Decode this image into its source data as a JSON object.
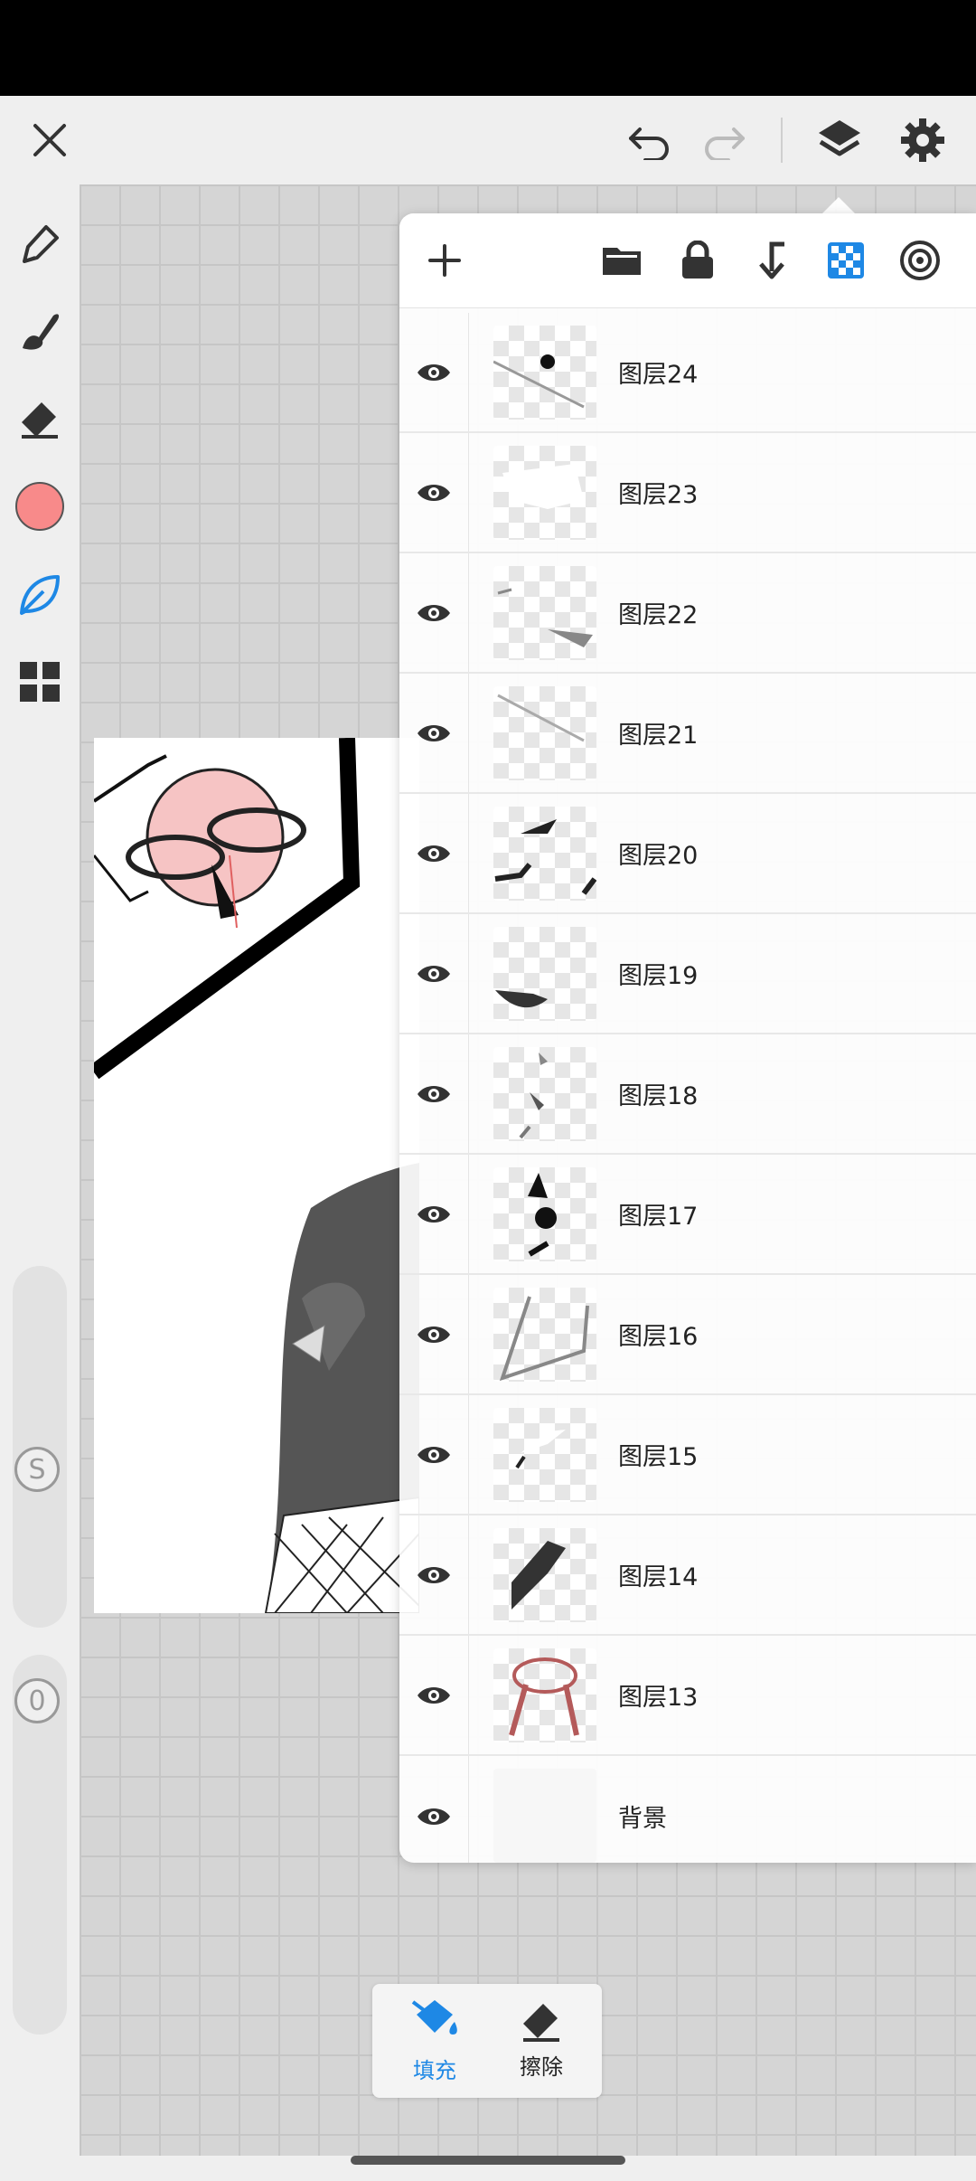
{
  "topbar": {
    "close_icon": "close-icon",
    "undo_icon": "undo-icon",
    "redo_icon": "redo-icon",
    "layers_icon": "layers-icon",
    "settings_icon": "gear-icon"
  },
  "sidebar": {
    "tools": [
      "pen-icon",
      "brush-icon",
      "eraser-icon",
      "color-swatch",
      "leaf-brush-icon",
      "grid-menu-icon"
    ],
    "current_color": "#f88a8a",
    "size_slider_label": "S",
    "opacity_slider_label": "0"
  },
  "layers_panel": {
    "toolbar_icons": [
      "add-icon",
      "folder-icon",
      "lock-icon",
      "merge-down-icon",
      "transparency-icon",
      "target-icon"
    ],
    "layers": [
      {
        "name": "图层24"
      },
      {
        "name": "图层23"
      },
      {
        "name": "图层22"
      },
      {
        "name": "图层21"
      },
      {
        "name": "图层20"
      },
      {
        "name": "图层19"
      },
      {
        "name": "图层18"
      },
      {
        "name": "图层17"
      },
      {
        "name": "图层16"
      },
      {
        "name": "图层15"
      },
      {
        "name": "图层14"
      },
      {
        "name": "图层13"
      }
    ],
    "background_layer": "背景"
  },
  "bottom_tools": {
    "fill_label": "填充",
    "erase_label": "擦除"
  },
  "colors": {
    "accent": "#1e88e5",
    "toolbar_bg": "#efefef"
  }
}
